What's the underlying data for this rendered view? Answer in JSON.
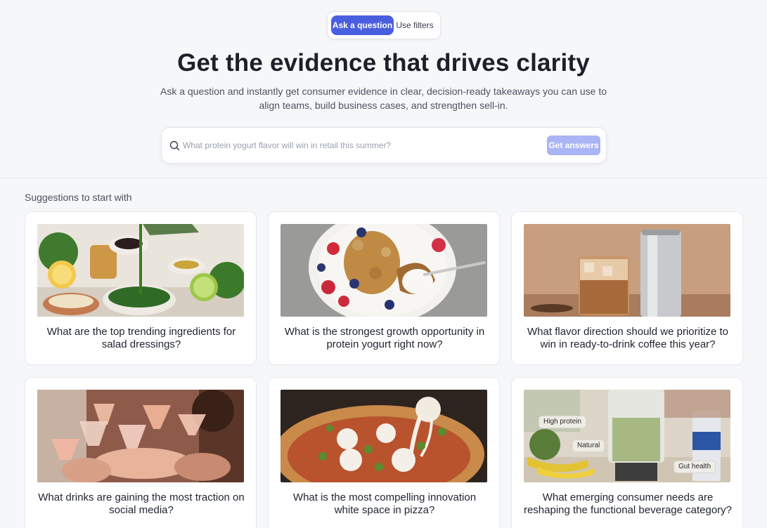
{
  "mode_toggle": {
    "active_label": "Ask a question",
    "inactive_label": "Use filters"
  },
  "hero": {
    "headline": "Get the evidence that drives clarity",
    "subtext": "Ask a question and instantly get consumer evidence in clear, decision-ready takeaways you can use to align teams, build business cases, and strengthen sell-in."
  },
  "search": {
    "placeholder": "What protein yogurt flavor will win in retail this summer?",
    "button_label": "Get answers"
  },
  "suggestions": {
    "title": "Suggestions to start with",
    "cards": [
      {
        "question": "What are the top trending ingredients for salad dressings?",
        "image": "salad-dressing-ingredients-photo"
      },
      {
        "question": "What is the strongest growth opportunity in protein yogurt right now?",
        "image": "yogurt-bowl-photo"
      },
      {
        "question": "What flavor direction should we prioritize to win in ready-to-drink coffee this year?",
        "image": "iced-coffee-can-photo"
      },
      {
        "question": "What drinks are gaining the most traction on social media?",
        "image": "cocktail-toast-photo"
      },
      {
        "question": "What is the most compelling innovation white space in pizza?",
        "image": "pizza-photo"
      },
      {
        "question": "What emerging consumer needs are reshaping the functional beverage category?",
        "image": "smoothie-blender-photo",
        "tags": [
          "High protein",
          "Natural",
          "Gut health"
        ]
      }
    ]
  },
  "colors": {
    "accent": "#4a5fe0",
    "accent_disabled": "#aab5f5",
    "page_bg": "#f6f7f9"
  }
}
